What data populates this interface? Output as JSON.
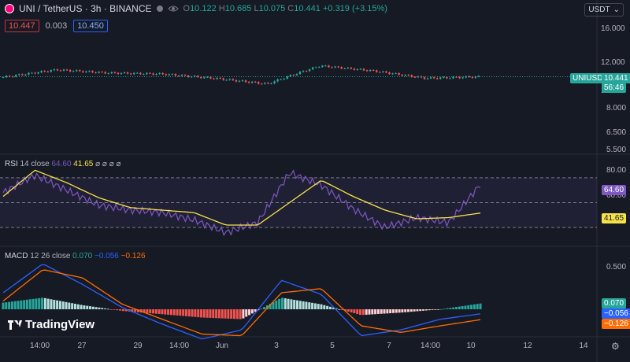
{
  "header": {
    "title": "UNI / TetherUS · 3h · BINANCE",
    "ohlc": {
      "o_label": "O",
      "o": "10.122",
      "h_label": "H",
      "h": "10.685",
      "l_label": "L",
      "l": "10.075",
      "c_label": "C",
      "c": "10.441",
      "change": "+0.319 (+3.15%)"
    },
    "bid": "10.447",
    "spread": "0.003",
    "ask": "10.450",
    "currency": "USDT",
    "up_color": "#26a69a",
    "down_color": "#ef5350"
  },
  "price_axis": {
    "ticks": [
      "16.000",
      "12.000",
      "10.000",
      "8.000",
      "6.500",
      "5.500"
    ]
  },
  "price_label": {
    "symbol": "UNIUSDT",
    "price": "10.441",
    "timer": "56:46"
  },
  "rsi": {
    "legend_name": "RSI",
    "legend_params": "14 close",
    "value": "64.60",
    "ma_value": "41.65",
    "extra": "⌀ ⌀ ⌀ ⌀",
    "ticks": [
      "80.00",
      "60.00"
    ],
    "value_color": "#7e57c2",
    "ma_color": "#f7e14a"
  },
  "macd": {
    "legend_name": "MACD",
    "legend_params": "12 26 close",
    "hist": "0.070",
    "macd": "−0.056",
    "signal": "−0.126",
    "ticks": [
      "0.500"
    ]
  },
  "time_axis": {
    "labels": [
      "14:00",
      "27",
      "29",
      "14:00",
      "Jun",
      "3",
      "5",
      "7",
      "14:00",
      "10",
      "12",
      "14"
    ]
  },
  "branding": "TradingView",
  "chart_data": [
    {
      "type": "line",
      "title": "UNI / TetherUS · 3h · BINANCE",
      "ylim": [
        5.5,
        16
      ],
      "y_scale": "log",
      "x": [
        "14:00",
        "27",
        "29",
        "14:00",
        "Jun",
        "3",
        "5",
        "7",
        "14:00",
        "10"
      ],
      "series": [
        {
          "values": [
            10.4,
            11.1,
            10.8,
            10.7,
            10.3,
            9.8,
            11.5,
            11.0,
            10.3,
            10.44
          ]
        }
      ]
    },
    {
      "type": "line",
      "title": "RSI 14 close",
      "ylim": [
        20,
        80
      ],
      "series": [
        {
          "name": "RSI",
          "values": [
            58,
            72,
            60,
            48,
            44,
            42,
            36,
            26,
            34,
            74,
            64,
            45,
            30,
            38,
            34,
            64.6
          ]
        },
        {
          "name": "RSI-based MA",
          "values": [
            55,
            76,
            66,
            54,
            46,
            44,
            42,
            32,
            32,
            50,
            68,
            55,
            44,
            37,
            38,
            41.65
          ]
        }
      ]
    },
    {
      "type": "bar",
      "title": "MACD 12 26 close",
      "series": [
        {
          "name": "Histogram",
          "values": [
            0.08,
            0.14,
            0.05,
            -0.02,
            -0.06,
            -0.1,
            -0.12,
            0.14,
            0.06,
            -0.07,
            -0.04,
            0.0,
            0.07
          ]
        },
        {
          "name": "MACD",
          "values": [
            0.2,
            0.55,
            0.3,
            0.02,
            -0.18,
            -0.36,
            -0.25,
            0.35,
            0.18,
            -0.32,
            -0.25,
            -0.12,
            -0.056
          ]
        },
        {
          "name": "Signal",
          "values": [
            0.1,
            0.48,
            0.38,
            0.06,
            -0.12,
            -0.3,
            -0.32,
            0.2,
            0.25,
            -0.2,
            -0.28,
            -0.2,
            -0.126
          ]
        }
      ]
    }
  ]
}
